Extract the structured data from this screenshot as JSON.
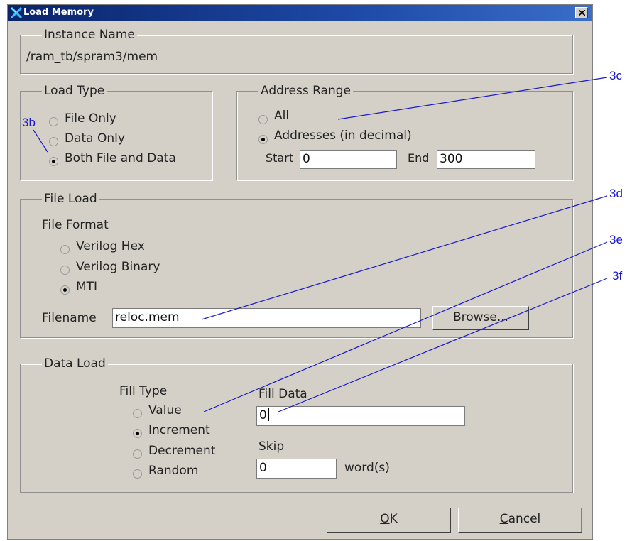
{
  "dialog": {
    "title": "Load Memory",
    "close_symbol": "×"
  },
  "instance": {
    "legend": "Instance Name",
    "value": "/ram_tb/spram3/mem"
  },
  "load_type": {
    "legend": "Load Type",
    "options": [
      "File Only",
      "Data Only",
      "Both File and Data"
    ],
    "selected": "Both File and Data"
  },
  "address_range": {
    "legend": "Address Range",
    "options": [
      "All",
      "Addresses (in decimal)"
    ],
    "selected": "Addresses (in decimal)",
    "start_label": "Start",
    "start_value": "0",
    "end_label": "End",
    "end_value": "300"
  },
  "file_load": {
    "legend": "File Load",
    "format_label": "File Format",
    "formats": [
      "Verilog Hex",
      "Verilog Binary",
      "MTI"
    ],
    "selected": "MTI",
    "filename_label": "Filename",
    "filename_value": "reloc.mem",
    "browse_label": "Browse..."
  },
  "data_load": {
    "legend": "Data Load",
    "fill_type_label": "Fill Type",
    "fill_types": [
      "Value",
      "Increment",
      "Decrement",
      "Random"
    ],
    "selected": "Increment",
    "fill_data_label": "Fill Data",
    "fill_data_value": "0",
    "skip_label": "Skip",
    "skip_value": "0",
    "skip_unit": "word(s)"
  },
  "buttons": {
    "ok_label": "OK",
    "ok_mnemonic": "O",
    "ok_rest": "K",
    "cancel_label": "Cancel",
    "cancel_mnemonic": "C",
    "cancel_rest": "ancel"
  },
  "callouts": [
    "3b",
    "3c",
    "3d",
    "3e",
    "3f"
  ],
  "colors": {
    "titlebar": "#0a246a",
    "dialog_bg": "#d4d0c8",
    "callout": "#1a1acc"
  },
  "icons": [
    "load-memory-app-icon",
    "close-icon",
    "radio-icon"
  ]
}
